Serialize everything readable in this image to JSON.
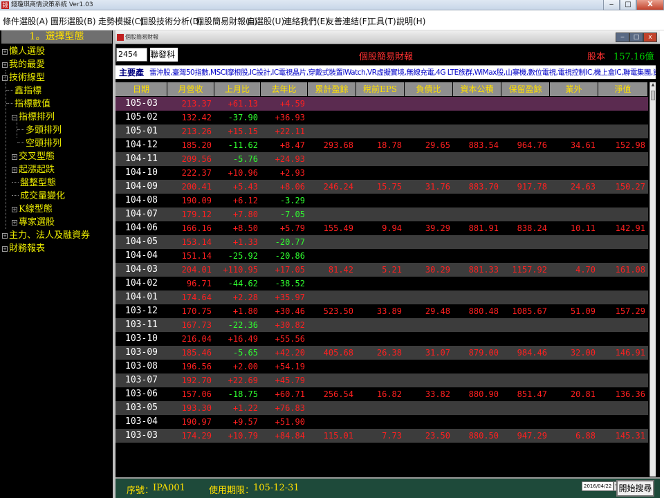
{
  "window": {
    "title": "錢瓊琪商情決策系統 Ver1.03",
    "min_label": "‒",
    "max_label": "□",
    "close_label": "X"
  },
  "menu": [
    "條件選股(A)",
    "圖形選股(B)",
    "走勢模擬(C)",
    "個股技術分析(D)",
    "個股簡易財報(E)",
    "自選股(U)",
    "連絡我們(E)",
    "友善連結(F)",
    "工具(T)",
    "說明(H)"
  ],
  "left_panel": {
    "header": "1。選擇型態",
    "tree": [
      {
        "label": "懶人選股",
        "marker": "+"
      },
      {
        "label": "我的最愛",
        "marker": "+"
      },
      {
        "label": "技術線型",
        "marker": "−"
      },
      {
        "label": "鑫指標",
        "marker": ""
      },
      {
        "label": "指標數值",
        "marker": ""
      },
      {
        "label": "指標排列",
        "marker": "−"
      },
      {
        "label": "多頭排列",
        "marker": ""
      },
      {
        "label": "空頭排列",
        "marker": ""
      },
      {
        "label": "交叉型態",
        "marker": "+"
      },
      {
        "label": "起漲起跌",
        "marker": "+"
      },
      {
        "label": "盤整型態",
        "marker": ""
      },
      {
        "label": "成交量變化",
        "marker": ""
      },
      {
        "label": "K線型態",
        "marker": "+"
      },
      {
        "label": "專家選股",
        "marker": "+"
      },
      {
        "label": "主力、法人及融資券",
        "marker": "+"
      },
      {
        "label": "財務報表",
        "marker": "+"
      }
    ]
  },
  "child_window": {
    "title": "個股簡易財報",
    "min_label": "‒",
    "max_label": "□",
    "close_label": "x"
  },
  "stock": {
    "code": "2454",
    "name": "聯發科",
    "report_title": "個股簡易財報",
    "capital_label": "股本",
    "capital_value": "157.16億"
  },
  "business": {
    "label": "主要產",
    "text": "雷沖股,臺灣50指數,MSCI摩根股,IC設計,IC電視晶片,穿戴式裝置iWatch,VR虛擬實境,無線充電,4G LTE族群,WiMax股,山寨機,數位電視,電視控制IC,機上盒IC,聯電集團,資訊科"
  },
  "table": {
    "headers": [
      "日期",
      "月營收",
      "上月比",
      "去年比",
      "累計盈餘",
      "稅前EPS",
      "負債比",
      "資本公積",
      "保留盈餘",
      "業外",
      "淨值"
    ],
    "rows": [
      [
        "105-03",
        "213.37",
        "+61.13",
        "+4.59",
        "",
        "",
        "",
        "",
        "",
        "",
        ""
      ],
      [
        "105-02",
        "132.42",
        "-37.90",
        "+36.93",
        "",
        "",
        "",
        "",
        "",
        "",
        ""
      ],
      [
        "105-01",
        "213.26",
        "+15.15",
        "+22.11",
        "",
        "",
        "",
        "",
        "",
        "",
        ""
      ],
      [
        "104-12",
        "185.20",
        "-11.62",
        "+8.47",
        "293.68",
        "18.78",
        "29.65",
        "883.54",
        "964.76",
        "34.61",
        "152.98"
      ],
      [
        "104-11",
        "209.56",
        "-5.76",
        "+24.93",
        "",
        "",
        "",
        "",
        "",
        "",
        ""
      ],
      [
        "104-10",
        "222.37",
        "+10.96",
        "+2.93",
        "",
        "",
        "",
        "",
        "",
        "",
        ""
      ],
      [
        "104-09",
        "200.41",
        "+5.43",
        "+8.06",
        "246.24",
        "15.75",
        "31.76",
        "883.70",
        "917.78",
        "24.63",
        "150.27"
      ],
      [
        "104-08",
        "190.09",
        "+6.12",
        "-3.29",
        "",
        "",
        "",
        "",
        "",
        "",
        ""
      ],
      [
        "104-07",
        "179.12",
        "+7.80",
        "-7.05",
        "",
        "",
        "",
        "",
        "",
        "",
        ""
      ],
      [
        "104-06",
        "166.16",
        "+8.50",
        "+5.79",
        "155.49",
        "9.94",
        "39.29",
        "881.91",
        "838.24",
        "10.11",
        "142.91"
      ],
      [
        "104-05",
        "153.14",
        "+1.33",
        "-20.77",
        "",
        "",
        "",
        "",
        "",
        "",
        ""
      ],
      [
        "104-04",
        "151.14",
        "-25.92",
        "-20.86",
        "",
        "",
        "",
        "",
        "",
        "",
        ""
      ],
      [
        "104-03",
        "204.01",
        "+110.95",
        "+17.05",
        "81.42",
        "5.21",
        "30.29",
        "881.33",
        "1157.92",
        "4.70",
        "161.08"
      ],
      [
        "104-02",
        "96.71",
        "-44.62",
        "-38.52",
        "",
        "",
        "",
        "",
        "",
        "",
        ""
      ],
      [
        "104-01",
        "174.64",
        "+2.28",
        "+35.97",
        "",
        "",
        "",
        "",
        "",
        "",
        ""
      ],
      [
        "103-12",
        "170.75",
        "+1.80",
        "+30.46",
        "523.50",
        "33.89",
        "29.48",
        "880.48",
        "1085.67",
        "51.09",
        "157.29"
      ],
      [
        "103-11",
        "167.73",
        "-22.36",
        "+30.82",
        "",
        "",
        "",
        "",
        "",
        "",
        ""
      ],
      [
        "103-10",
        "216.04",
        "+16.49",
        "+55.56",
        "",
        "",
        "",
        "",
        "",
        "",
        ""
      ],
      [
        "103-09",
        "185.46",
        "-5.65",
        "+42.20",
        "405.68",
        "26.38",
        "31.07",
        "879.00",
        "984.46",
        "32.00",
        "146.91"
      ],
      [
        "103-08",
        "196.56",
        "+2.00",
        "+54.19",
        "",
        "",
        "",
        "",
        "",
        "",
        ""
      ],
      [
        "103-07",
        "192.70",
        "+22.69",
        "+45.79",
        "",
        "",
        "",
        "",
        "",
        "",
        ""
      ],
      [
        "103-06",
        "157.06",
        "-18.75",
        "+60.71",
        "256.54",
        "16.82",
        "33.82",
        "880.90",
        "851.47",
        "20.81",
        "136.36"
      ],
      [
        "103-05",
        "193.30",
        "+1.22",
        "+76.83",
        "",
        "",
        "",
        "",
        "",
        "",
        ""
      ],
      [
        "103-04",
        "190.97",
        "+9.57",
        "+51.90",
        "",
        "",
        "",
        "",
        "",
        "",
        ""
      ],
      [
        "103-03",
        "174.29",
        "+10.79",
        "+84.84",
        "115.01",
        "7.73",
        "23.50",
        "880.50",
        "947.29",
        "6.88",
        "145.31"
      ]
    ],
    "colors": {
      "up": "#ff2020",
      "down": "#30ff30",
      "date": "#ffffff"
    },
    "selected_row": 0
  },
  "status": {
    "serial_label": "序號：",
    "serial_value": "IPA001",
    "expiry_label": "使用期限：",
    "expiry_value": "105-12-31",
    "date_value": "2016/04/22",
    "search_button": "開始搜尋"
  }
}
